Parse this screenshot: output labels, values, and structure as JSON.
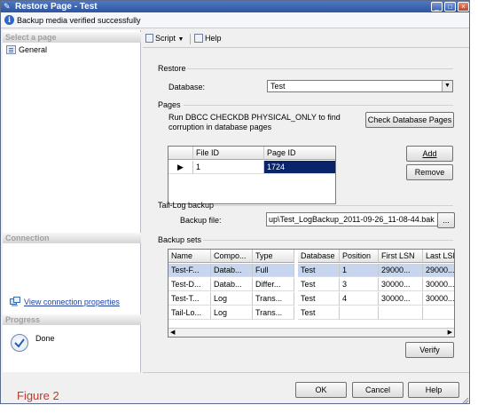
{
  "window": {
    "title": "Restore Page - Test",
    "status_message": "Backup media verified successfully"
  },
  "left_pane": {
    "select_header": "Select a page",
    "pages": [
      {
        "label": "General"
      }
    ],
    "connection_header": "Connection",
    "connection_link": "View connection properties",
    "progress_header": "Progress",
    "progress_status": "Done"
  },
  "toolbar": {
    "script": "Script",
    "help": "Help"
  },
  "restore": {
    "group_label": "Restore",
    "database_label": "Database:",
    "database_value": "Test"
  },
  "pages": {
    "group_label": "Pages",
    "description": "Run DBCC CHECKDB PHYSICAL_ONLY to find corruption in database pages",
    "check_button": "Check Database Pages",
    "columns": [
      "File ID",
      "Page ID"
    ],
    "rows": [
      {
        "file_id": "1",
        "page_id": "1724"
      }
    ],
    "add_button": "Add",
    "remove_button": "Remove"
  },
  "tail_log": {
    "group_label": "Tail-Log backup",
    "file_label": "Backup file:",
    "file_value": "up\\Test_LogBackup_2011-09-26_11-08-44.bak",
    "browse_button": "..."
  },
  "backup_sets": {
    "group_label": "Backup sets",
    "columns": [
      "Name",
      "Compo...",
      "Type",
      "Database",
      "Position",
      "First LSN",
      "Last LSN"
    ],
    "rows": [
      [
        "Test-F...",
        "Datab...",
        "Full",
        "Test",
        "1",
        "29000...",
        "29000..."
      ],
      [
        "Test-D...",
        "Datab...",
        "Differ...",
        "Test",
        "3",
        "30000...",
        "30000..."
      ],
      [
        "Test-T...",
        "Log",
        "Trans...",
        "Test",
        "4",
        "30000...",
        "30000..."
      ],
      [
        "Tail-Lo...",
        "Log",
        "Trans...",
        "Test",
        "",
        "",
        ""
      ]
    ],
    "verify_button": "Verify"
  },
  "buttons": {
    "ok": "OK",
    "cancel": "Cancel",
    "help": "Help"
  },
  "figure_label": "Figure 2"
}
